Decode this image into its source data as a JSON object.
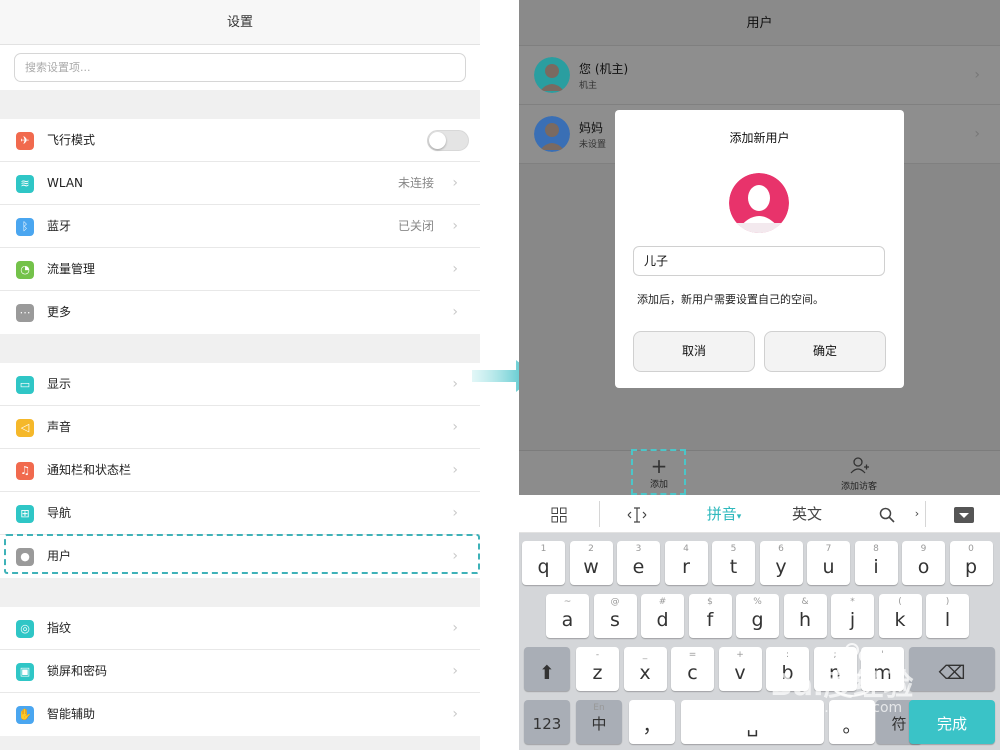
{
  "left": {
    "title": "设置",
    "search_placeholder": "搜索设置项...",
    "group1": [
      {
        "label": "飞行模式",
        "icon": "airplane-icon",
        "color": "#f16a4e",
        "toggle": true,
        "toggle_on": false
      },
      {
        "label": "WLAN",
        "icon": "wifi-icon",
        "color": "#2fc6c6",
        "value": "未连接"
      },
      {
        "label": "蓝牙",
        "icon": "bluetooth-icon",
        "color": "#4aa6f0",
        "value": "已关闭"
      },
      {
        "label": "流量管理",
        "icon": "data-usage-icon",
        "color": "#74c24a"
      },
      {
        "label": "更多",
        "icon": "more-icon",
        "color": "#9a9a9a"
      }
    ],
    "group2": [
      {
        "label": "显示",
        "icon": "display-icon",
        "color": "#2fc6c6"
      },
      {
        "label": "声音",
        "icon": "sound-icon",
        "color": "#f5b82a"
      },
      {
        "label": "通知栏和状态栏",
        "icon": "bell-icon",
        "color": "#f16a4e"
      },
      {
        "label": "导航",
        "icon": "navigation-icon",
        "color": "#2fc6c6"
      },
      {
        "label": "用户",
        "icon": "user-icon",
        "color": "#9a9a9a"
      }
    ],
    "group3": [
      {
        "label": "指纹",
        "icon": "fingerprint-icon",
        "color": "#2fc6c6"
      },
      {
        "label": "锁屏和密码",
        "icon": "lock-icon",
        "color": "#2fc6c6"
      },
      {
        "label": "智能辅助",
        "icon": "hand-icon",
        "color": "#4aa6f0"
      }
    ]
  },
  "right": {
    "title": "用户",
    "users": [
      {
        "name": "您 (机主)",
        "sub": "机主",
        "avatar_color": "#2a9ea0"
      },
      {
        "name": "妈妈",
        "sub": "未设置",
        "avatar_color": "#3a6fb5"
      }
    ],
    "dialog": {
      "title": "添加新用户",
      "input_value": "儿子",
      "hint": "添加后，新用户需要设置自己的空间。",
      "cancel": "取消",
      "confirm": "确定",
      "avatar_color": "#e8336b"
    },
    "bottom_bar": {
      "add": "添加",
      "add_guest": "添加访客"
    },
    "keyboard_toolbar": {
      "pinyin": "拼音",
      "english": "英文"
    },
    "keyboard": {
      "row1": [
        [
          "q",
          "1"
        ],
        [
          "w",
          "2"
        ],
        [
          "e",
          "3"
        ],
        [
          "r",
          "4"
        ],
        [
          "t",
          "5"
        ],
        [
          "y",
          "6"
        ],
        [
          "u",
          "7"
        ],
        [
          "i",
          "8"
        ],
        [
          "o",
          "9"
        ],
        [
          "p",
          "0"
        ]
      ],
      "row2": [
        [
          "a",
          "~"
        ],
        [
          "s",
          "@"
        ],
        [
          "d",
          "#"
        ],
        [
          "f",
          "$"
        ],
        [
          "g",
          "%"
        ],
        [
          "h",
          "&"
        ],
        [
          "j",
          "*"
        ],
        [
          "k",
          "("
        ],
        [
          "l",
          ")"
        ]
      ],
      "row3": [
        [
          "z",
          "-"
        ],
        [
          "x",
          "_"
        ],
        [
          "c",
          "="
        ],
        [
          "v",
          "+"
        ],
        [
          "b",
          ":"
        ],
        [
          "n",
          ";"
        ],
        [
          "m",
          "'"
        ]
      ],
      "num_key": "123",
      "lang_key_top": "En",
      "lang_key": "中",
      "comma": "，",
      "period": "。",
      "symbol": "符",
      "done": "完成",
      "accent_color": "#3ac3c7"
    }
  },
  "watermark": {
    "brand": "Bai度经验",
    "url": "jingyan.baidu.com"
  }
}
